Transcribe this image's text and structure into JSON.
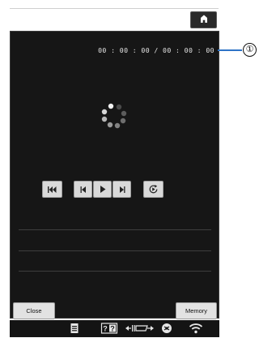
{
  "screen": {
    "timecode": "00 : 00 : 00 / 00 : 00 : 00",
    "callout_number": "①"
  },
  "controls": {
    "skip_back_icon": "skip-to-start",
    "prev_icon": "previous",
    "play_icon": "play",
    "next_icon": "next",
    "repeat_icon": "repeat-play"
  },
  "buttons": {
    "close_label": "Close",
    "memory_label": "Memory"
  },
  "home_icon": "home",
  "status_icons": [
    "document",
    "help",
    "needle-position",
    "thread-spool",
    "wifi"
  ],
  "colors": {
    "screen_bg": "#161616",
    "callout_line": "#2f74c7"
  }
}
